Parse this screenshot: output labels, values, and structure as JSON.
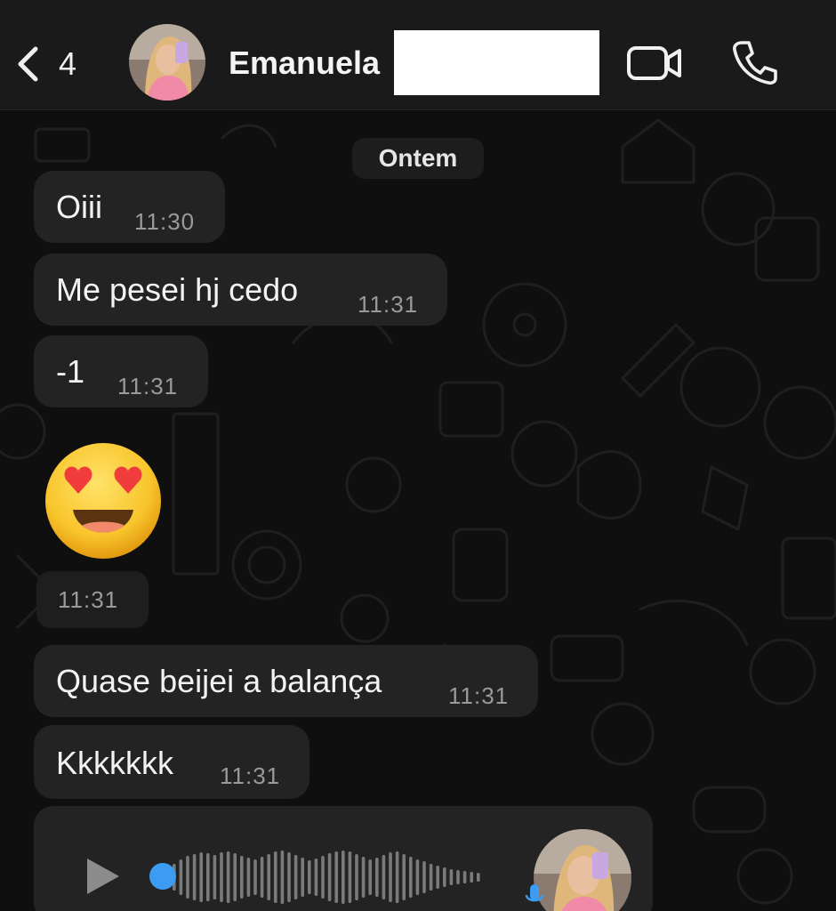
{
  "header": {
    "unread_count": "4",
    "contact_name": "Emanuela"
  },
  "chat": {
    "date_label": "Ontem",
    "messages": [
      {
        "text": "Oiii",
        "time": "11:30"
      },
      {
        "text": "Me pesei hj cedo",
        "time": "11:31"
      },
      {
        "text": "-1",
        "time": "11:31"
      },
      {
        "emoji": "smiling-face-with-heart-eyes",
        "time": "11:31"
      },
      {
        "text": "Quase beijei a balança",
        "time": "11:31"
      },
      {
        "text": "Kkkkkkk",
        "time": "11:31"
      }
    ],
    "voice_message": {
      "played_fraction": 0
    }
  },
  "colors": {
    "header_bg": "#1a1a1a",
    "bubble_bg": "#232323",
    "accent_blue": "#3b9cf2",
    "chat_bg": "#0f0f0f"
  }
}
